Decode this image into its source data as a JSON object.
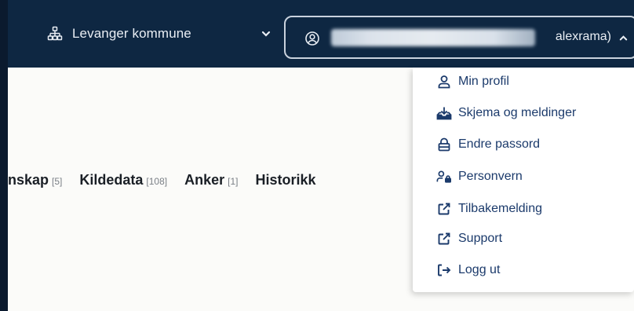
{
  "header": {
    "org_name": "Levanger kommune",
    "user_label_visible": "alexrama)"
  },
  "tabs": [
    {
      "label": "nskap",
      "count": "[5]"
    },
    {
      "label": "Kildedata",
      "count": "[108]"
    },
    {
      "label": "Anker",
      "count": "[1]"
    },
    {
      "label": "Historikk",
      "count": ""
    }
  ],
  "user_menu": {
    "items": [
      {
        "label": "Min profil",
        "icon": "user-icon"
      },
      {
        "label": "Skjema og meldinger",
        "icon": "inbox-download-icon"
      },
      {
        "label": "Endre passord",
        "icon": "lock-icon"
      },
      {
        "label": "Personvern",
        "icon": "user-lock-icon"
      },
      {
        "label": "Tilbakemelding",
        "icon": "external-link-icon"
      },
      {
        "label": "Support",
        "icon": "external-link-icon"
      },
      {
        "label": "Logg ut",
        "icon": "logout-icon"
      }
    ]
  },
  "colors": {
    "header_bg": "#0e2742",
    "menu_text": "#1b3a6b",
    "page_bg": "#fbfbf9"
  }
}
